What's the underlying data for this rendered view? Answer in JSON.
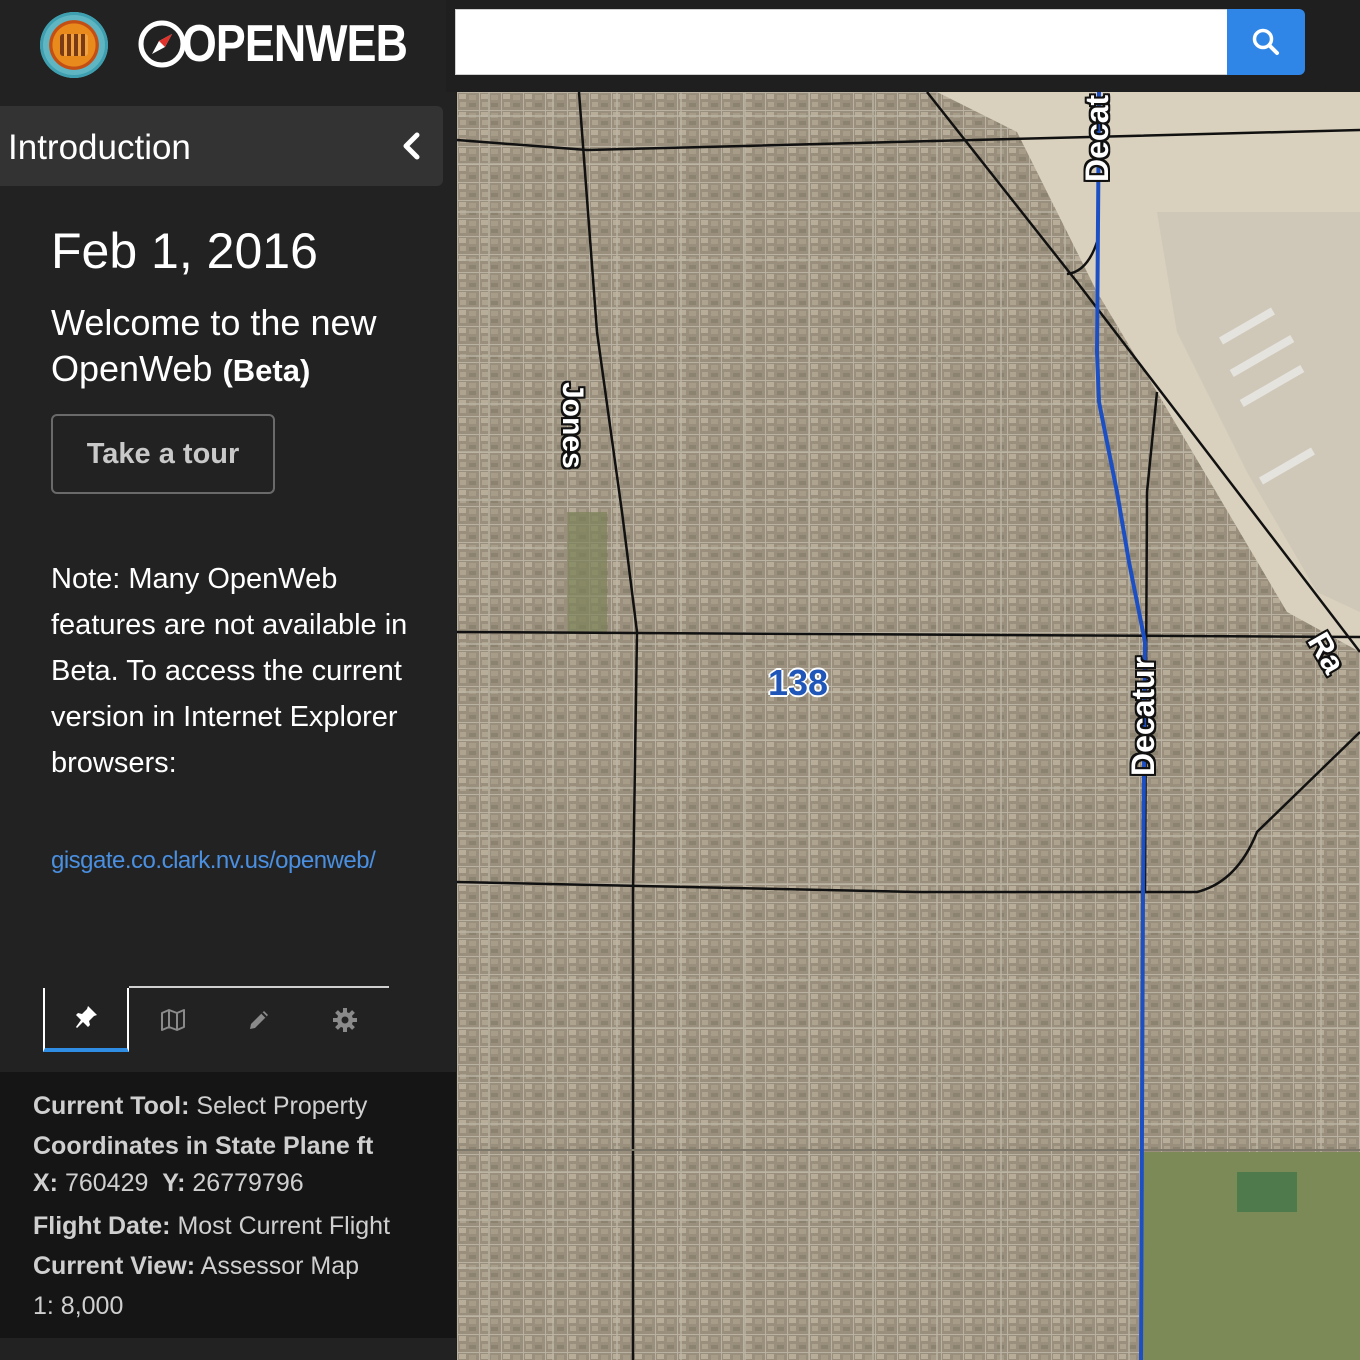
{
  "brand": {
    "logo_text": "OPENWEB",
    "seal": "clark-county-seal"
  },
  "sidebar": {
    "section_title": "Introduction",
    "date": "Feb 1, 2016",
    "welcome_line1": "Welcome to the new",
    "welcome_line2": "OpenWeb",
    "welcome_beta": "(Beta)",
    "tour_button": "Take a tour",
    "note": "Note: Many OpenWeb features are not available in Beta. To access the current version in Internet Explorer browsers:",
    "link": "gisgate.co.clark.nv.us/openweb/",
    "tabs": [
      {
        "icon": "pin-icon",
        "active": true
      },
      {
        "icon": "map-icon",
        "active": false
      },
      {
        "icon": "pencil-icon",
        "active": false
      },
      {
        "icon": "gear-icon",
        "active": false
      }
    ]
  },
  "status": {
    "tool_label": "Current Tool:",
    "tool_value": "Select Property",
    "coords_label": "Coordinates in State Plane ft",
    "x_label": "X:",
    "x_value": "760429",
    "y_label": "Y:",
    "y_value": "26779796",
    "flight_label": "Flight Date:",
    "flight_value": "Most Current Flight",
    "view_label": "Current View:",
    "view_value": "Assessor Map",
    "scale": "1: 8,000"
  },
  "search": {
    "placeholder": "",
    "button_icon": "search-icon"
  },
  "map": {
    "labels": {
      "jones": "Jones",
      "decatur_top": "Decat",
      "decatur": "Decatur",
      "rancho": "Ra"
    },
    "area_number": "138",
    "colors": {
      "accent": "#2f86e6",
      "link": "#4a8fe0",
      "route": "#1d4fc4"
    }
  }
}
